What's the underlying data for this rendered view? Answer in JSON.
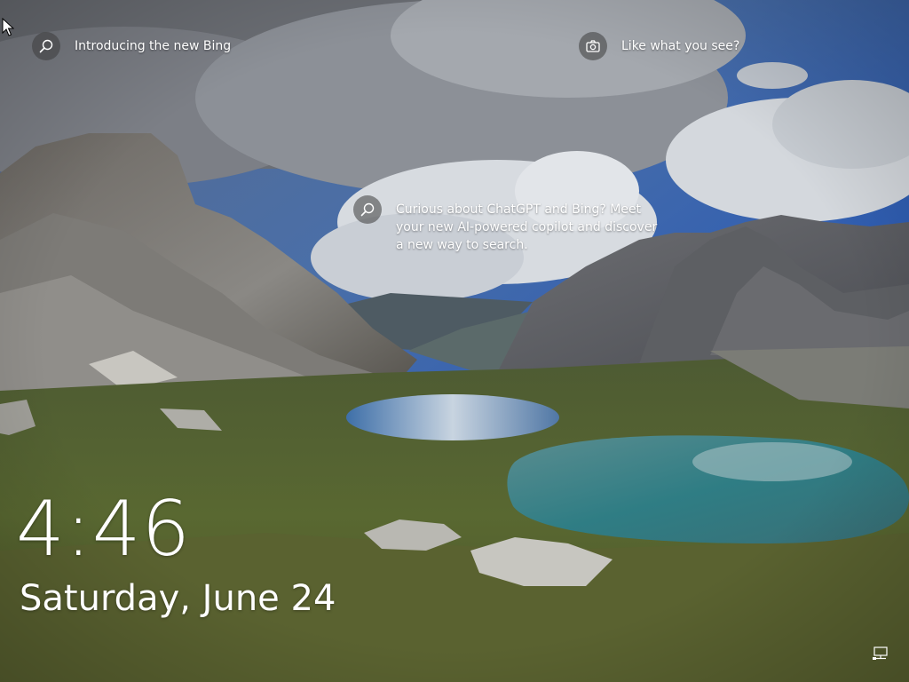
{
  "screen": "lock-screen",
  "spotlight": {
    "bing_hotspot": {
      "label": "Introducing the new Bing",
      "icon": "search-icon"
    },
    "like_hotspot": {
      "label": "Like what you see?",
      "icon": "camera-icon"
    },
    "chatgpt_hotspot": {
      "label": "Curious about ChatGPT and Bing? Meet your new AI-powered copilot and discover a new way to search.",
      "icon": "search-icon"
    }
  },
  "clock": {
    "time": "4:46",
    "date": "Saturday, June 24"
  },
  "status": {
    "network_icon": "network-wired-icon"
  },
  "colors": {
    "text": "#ffffff",
    "icon_circle": "#3c3c3c"
  }
}
